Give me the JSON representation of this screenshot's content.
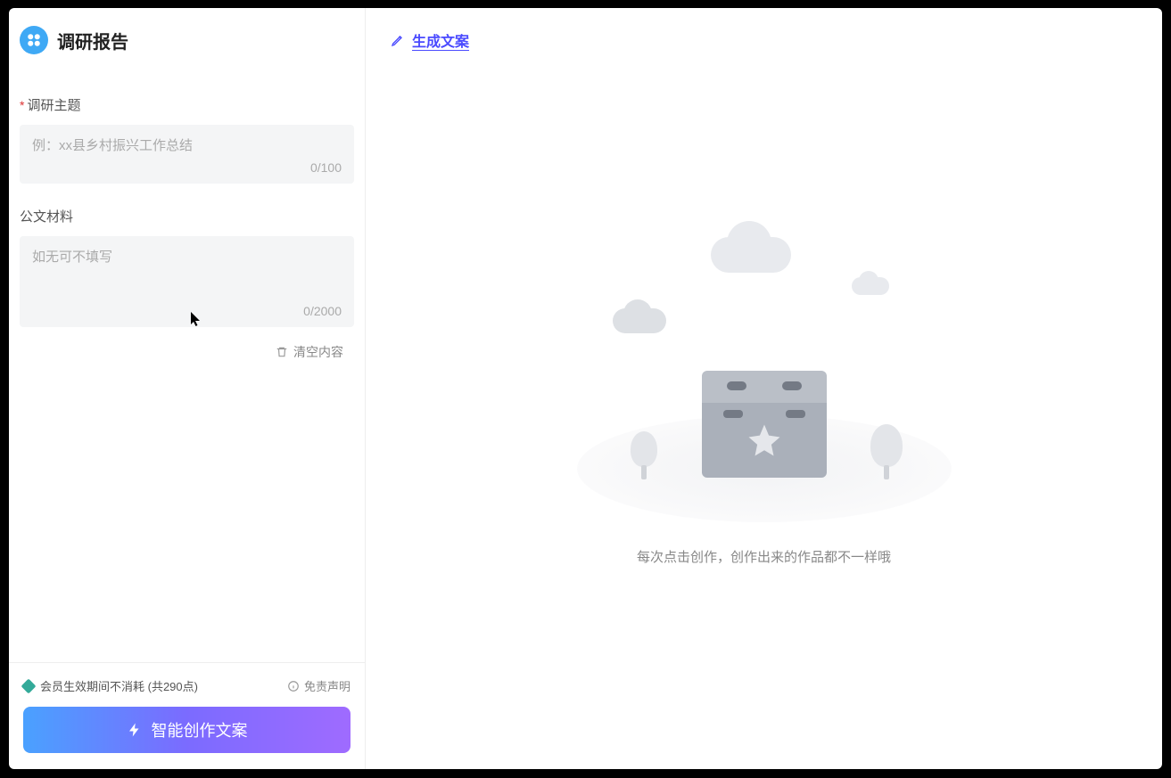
{
  "sidebar": {
    "title": "调研报告",
    "fields": {
      "topic": {
        "label": "调研主题",
        "required": true,
        "placeholder": "例：xx县乡村振兴工作总结",
        "value": "",
        "counter": "0/100"
      },
      "material": {
        "label": "公文材料",
        "required": false,
        "placeholder": "如无可不填写",
        "value": "",
        "counter": "0/2000"
      }
    },
    "clear_label": "清空内容"
  },
  "footer": {
    "credits_text": "会员生效期间不消耗 (共290点)",
    "disclaimer_label": "免责声明",
    "generate_button": "智能创作文案"
  },
  "content": {
    "header_label": "生成文案",
    "empty_text": "每次点击创作，创作出来的作品都不一样哦"
  },
  "icons": {
    "logo": "logo-icon",
    "pencil": "pencil-icon",
    "trash": "trash-icon",
    "info": "info-icon",
    "bolt": "bolt-icon",
    "star": "star-icon"
  }
}
